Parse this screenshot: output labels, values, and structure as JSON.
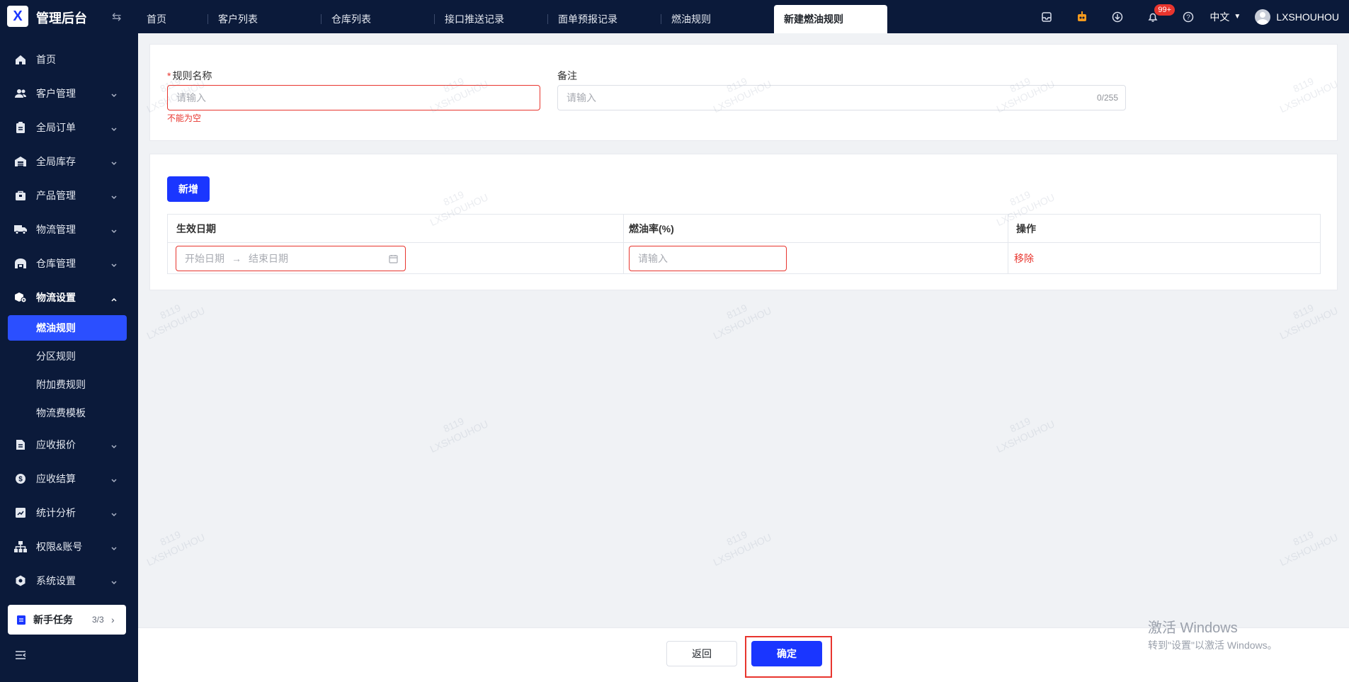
{
  "app": {
    "title": "管理后台",
    "logo_text": "X"
  },
  "tabs": [
    {
      "label": "首页"
    },
    {
      "label": "客户列表"
    },
    {
      "label": "仓库列表"
    },
    {
      "label": "接口推送记录"
    },
    {
      "label": "面单预报记录"
    },
    {
      "label": "燃油规则"
    },
    {
      "label": "新建燃油规则"
    }
  ],
  "header": {
    "notification_badge": "99+",
    "language": "中文",
    "username": "LXSHOUHOU"
  },
  "sidebar": {
    "items": [
      {
        "label": "首页",
        "icon": "home-icon"
      },
      {
        "label": "客户管理",
        "icon": "users-icon"
      },
      {
        "label": "全局订单",
        "icon": "clipboard-icon"
      },
      {
        "label": "全局库存",
        "icon": "warehouse-icon"
      },
      {
        "label": "产品管理",
        "icon": "bag-icon"
      },
      {
        "label": "物流管理",
        "icon": "truck-icon"
      },
      {
        "label": "仓库管理",
        "icon": "storehouse-icon"
      },
      {
        "label": "物流设置",
        "icon": "box-gear-icon"
      },
      {
        "label": "应收报价",
        "icon": "document-icon"
      },
      {
        "label": "应收结算",
        "icon": "coin-icon"
      },
      {
        "label": "统计分析",
        "icon": "chart-icon"
      },
      {
        "label": "权限&账号",
        "icon": "org-icon"
      },
      {
        "label": "系统设置",
        "icon": "hexagon-gear-icon"
      }
    ],
    "submenu": [
      {
        "label": "燃油规则"
      },
      {
        "label": "分区规则"
      },
      {
        "label": "附加费规则"
      },
      {
        "label": "物流费模板"
      }
    ],
    "task_card": {
      "label": "新手任务",
      "count": "3/3"
    }
  },
  "form": {
    "rule_name": {
      "label": "规则名称",
      "required_mark": "*",
      "placeholder": "请输入",
      "error": "不能为空"
    },
    "remark": {
      "label": "备注",
      "placeholder": "请输入",
      "counter": "0/255"
    }
  },
  "table_section": {
    "add_button": "新增",
    "columns": [
      "生效日期",
      "燃油率(%)",
      "操作"
    ],
    "row": {
      "start_placeholder": "开始日期",
      "end_placeholder": "结束日期",
      "rate_placeholder": "请输入",
      "action": "移除"
    }
  },
  "footer": {
    "back_label": "返回",
    "confirm_label": "确定"
  },
  "watermark": {
    "line1": "8119",
    "line2": "LXSHOUHOU"
  },
  "windows_activation": {
    "title": "激活 Windows",
    "subtitle": "转到\"设置\"以激活 Windows。"
  },
  "colors": {
    "primary": "#1a36ff",
    "sidebar_bg": "#0b1a3a",
    "error": "#e8352e",
    "page_bg": "#f0f2f5"
  }
}
